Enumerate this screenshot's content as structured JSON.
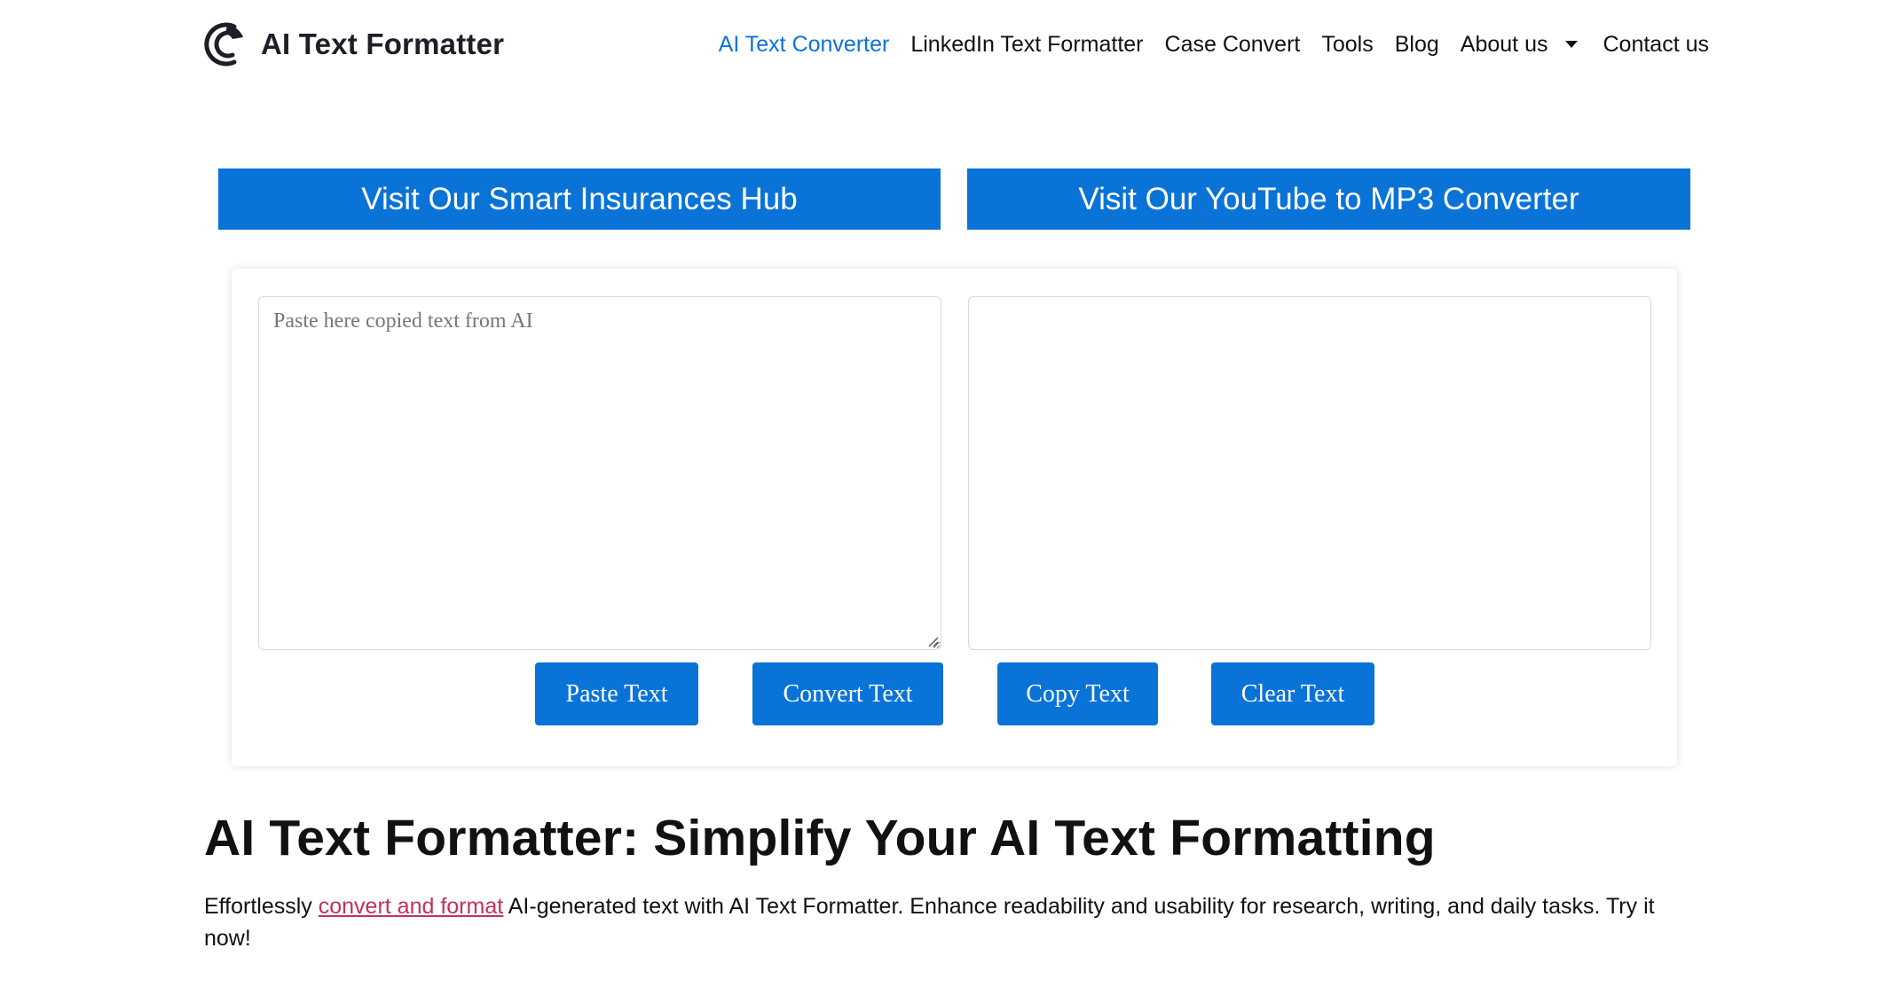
{
  "header": {
    "logo_text": "AI Text Formatter",
    "nav": [
      {
        "label": "AI Text Converter",
        "active": true
      },
      {
        "label": "LinkedIn Text Formatter",
        "active": false
      },
      {
        "label": "Case Convert",
        "active": false
      },
      {
        "label": "Tools",
        "active": false
      },
      {
        "label": "Blog",
        "active": false
      },
      {
        "label": "About us",
        "active": false,
        "has_dropdown": true
      },
      {
        "label": "Contact us",
        "active": false
      }
    ]
  },
  "promos": {
    "left_label": "Visit Our Smart Insurances Hub",
    "right_label": "Visit Our YouTube to MP3 Converter"
  },
  "converter": {
    "input_placeholder": "Paste here copied text from AI",
    "input_value": "",
    "output_value": "",
    "buttons": {
      "paste": "Paste Text",
      "convert": "Convert Text",
      "copy": "Copy Text",
      "clear": "Clear Text"
    }
  },
  "content": {
    "title": "AI Text Formatter: Simplify Your AI Text Formatting",
    "intro_before": "Effortlessly ",
    "intro_link": "convert and format",
    "intro_after": " AI-generated text with AI Text Formatter. Enhance readability and usability for research, writing, and daily tasks. Try it now!"
  },
  "colors": {
    "accent": "#0a73d8",
    "link": "#c4305e",
    "text": "#111111"
  },
  "icons": {
    "logo": "logo-arc-icon",
    "dropdown": "caret-down-icon",
    "resize": "resize-grip-icon"
  }
}
